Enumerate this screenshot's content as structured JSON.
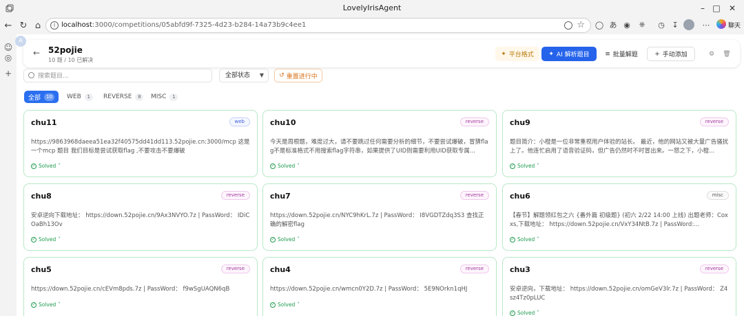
{
  "window": {
    "title": "LovelyIrisAgent"
  },
  "browser": {
    "url_host": "localhost",
    "url_path": ":3000/competitions/05abfd9f-7325-4d23-b284-14a73b9c4ee1",
    "copilot_label": "聊天"
  },
  "sidebar": {
    "avatar_letter": "A"
  },
  "header": {
    "title": "52pojie",
    "subtitle": "10 题 / 10 已解决",
    "platform_label": "平台格式",
    "ai_label": "AI 解析题目",
    "batch_label": "批量解题",
    "manual_label": "手动添加"
  },
  "filters": {
    "search_placeholder": "搜索题目...",
    "status_value": "全部状态",
    "reset_label": "重置进行中"
  },
  "tabs": [
    {
      "label": "全部",
      "count": "10"
    },
    {
      "label": "WEB",
      "count": "1"
    },
    {
      "label": "REVERSE",
      "count": "8"
    },
    {
      "label": "MISC",
      "count": "1"
    }
  ],
  "cards": [
    {
      "name": "chu11",
      "tag": "web",
      "desc": "https://9863968daeea51ea32f40575dd41dd113.52pojie.cn:3000/mcp 这是一个mcp 题目 我们目标是尝试获取flag ,不要攻击不要爆破",
      "status": "Solved"
    },
    {
      "name": "chu10",
      "tag": "reverse",
      "desc": "今天是周根题，难度过大，请不要跳过任何需要分析的细节，不要尝试爆破，冒猜flag不是标准格式不用搜索flag字符串，如果提供了UID则需要利用UID获取专属...",
      "status": "Solved"
    },
    {
      "name": "chu9",
      "tag": "reverse",
      "desc": "题目简介：小橙是一位非常重视用户体验的站长。 最近，他的网站又被大量广告骚扰上了。他连忙启用了语音验证码，但广告仍然时不时冒出来。一怒之下，小橙...",
      "status": "Solved"
    },
    {
      "name": "chu8",
      "tag": "reverse",
      "desc": "安卓逆向下载地址： https://down.52pojie.cn/9Ax3NVYO.7z | PassWord： IDiCOaBh13Ov",
      "status": "Solved"
    },
    {
      "name": "chu7",
      "tag": "reverse",
      "desc": "https://down.52pojie.cn/NYC9hKrL.7z | PassWord： I8VGDTZdq3S3 查找正确的解密flag",
      "status": "Solved"
    },
    {
      "name": "chu6",
      "tag": "misc",
      "desc": "【春节】解题领红包之六 {番外篇 初级题} (初六 2/22 14:00 上线) 出题老师：Coxxs,下载地址： https://down.52pojie.cn/VxY34NtB.7z | PassWord:...",
      "status": "Solved"
    },
    {
      "name": "chu5",
      "tag": "reverse",
      "desc": "https://down.52pojie.cn/cEVm8pds.7z | PassWord： f9wSgUAQN6qB",
      "status": "Solved"
    },
    {
      "name": "chu4",
      "tag": "reverse",
      "desc": "https://down.52pojie.cn/wmcn0Y2D.7z | PassWord： 5E9NOrkn1qHJ",
      "status": "Solved"
    },
    {
      "name": "chu3",
      "tag": "reverse",
      "desc": "安卓逆向，下载地址： https://down.52pojie.cn/omGeV3lr.7z | PassWord： Z4sz4Tz0pLUC",
      "status": "Solved"
    }
  ],
  "colors": {
    "accent": "#2563eb",
    "card_border": "#b7e8c6",
    "solved": "#1f9b4f"
  }
}
